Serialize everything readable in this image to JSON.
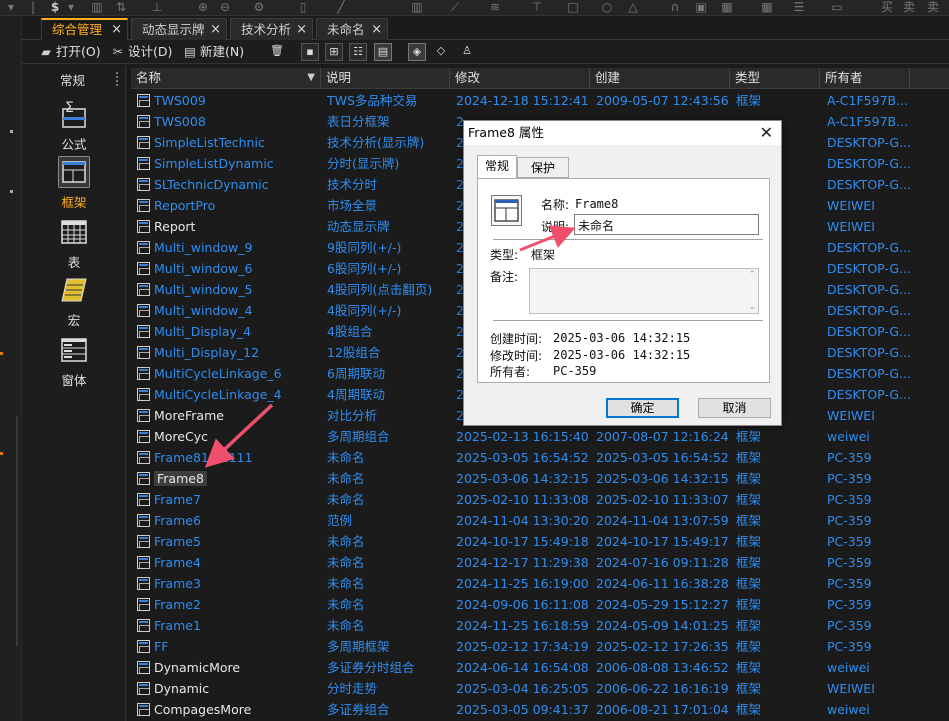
{
  "tabs": [
    {
      "label": "综合管理",
      "active": true
    },
    {
      "label": "动态显示牌",
      "active": false
    },
    {
      "label": "技术分析",
      "active": false
    },
    {
      "label": "未命名",
      "active": false
    }
  ],
  "toolbar": {
    "open_label": "打开(O)",
    "design_label": "设计(D)",
    "new_label": "新建(N)"
  },
  "sidebar": {
    "title": "常规",
    "items": [
      {
        "label": "公式",
        "icon": "formula-icon",
        "selected": false
      },
      {
        "label": "框架",
        "icon": "frame-icon",
        "selected": true
      },
      {
        "label": "表",
        "icon": "table-icon",
        "selected": false
      },
      {
        "label": "宏",
        "icon": "macro-icon",
        "selected": false
      },
      {
        "label": "窗体",
        "icon": "form-icon",
        "selected": false
      }
    ]
  },
  "grid": {
    "columns": [
      "名称",
      "说明",
      "修改",
      "创建",
      "类型",
      "所有者"
    ],
    "rows": [
      {
        "name": "TWS009",
        "desc": "TWS多品种交易",
        "modified": "2024-12-18 15:12:41",
        "created": "2009-05-07 12:43:56",
        "type": "框架",
        "owner": "A-C1F597B...",
        "name_color": "blue"
      },
      {
        "name": "TWS008",
        "desc": "表日分框架",
        "modified": "2",
        "created": "",
        "type": "",
        "owner": "A-C1F597B...",
        "name_color": "blue"
      },
      {
        "name": "SimpleListTechnic",
        "desc": "技术分析(显示牌)",
        "modified": "2",
        "created": "",
        "type": "",
        "owner": "DESKTOP-G...",
        "name_color": "blue"
      },
      {
        "name": "SimpleListDynamic",
        "desc": "分时(显示牌)",
        "modified": "2",
        "created": "",
        "type": "",
        "owner": "DESKTOP-G...",
        "name_color": "blue"
      },
      {
        "name": "SLTechnicDynamic",
        "desc": "技术分时",
        "modified": "2",
        "created": "",
        "type": "",
        "owner": "DESKTOP-G...",
        "name_color": "blue"
      },
      {
        "name": "ReportPro",
        "desc": "市场全景",
        "modified": "2",
        "created": "",
        "type": "",
        "owner": "WEIWEI",
        "name_color": "blue"
      },
      {
        "name": "Report",
        "desc": "动态显示牌",
        "modified": "2",
        "created": "",
        "type": "",
        "owner": "WEIWEI",
        "name_color": "white"
      },
      {
        "name": "Multi_window_9",
        "desc": "9股同列(+/-)",
        "modified": "2",
        "created": "",
        "type": "",
        "owner": "DESKTOP-G...",
        "name_color": "blue"
      },
      {
        "name": "Multi_window_6",
        "desc": "6股同列(+/-)",
        "modified": "2",
        "created": "",
        "type": "",
        "owner": "DESKTOP-G...",
        "name_color": "blue"
      },
      {
        "name": "Multi_window_5",
        "desc": "4股同列(点击翻页)",
        "modified": "2",
        "created": "",
        "type": "",
        "owner": "DESKTOP-G...",
        "name_color": "blue"
      },
      {
        "name": "Multi_window_4",
        "desc": "4股同列(+/-)",
        "modified": "2",
        "created": "",
        "type": "",
        "owner": "DESKTOP-G...",
        "name_color": "blue"
      },
      {
        "name": "Multi_Display_4",
        "desc": "4股组合",
        "modified": "2",
        "created": "",
        "type": "",
        "owner": "DESKTOP-G...",
        "name_color": "blue"
      },
      {
        "name": "Multi_Display_12",
        "desc": "12股组合",
        "modified": "2",
        "created": "",
        "type": "",
        "owner": "DESKTOP-G...",
        "name_color": "blue"
      },
      {
        "name": "MultiCycleLinkage_6",
        "desc": "6周期联动",
        "modified": "2",
        "created": "",
        "type": "",
        "owner": "DESKTOP-G...",
        "name_color": "blue"
      },
      {
        "name": "MultiCycleLinkage_4",
        "desc": "4周期联动",
        "modified": "2",
        "created": "",
        "type": "",
        "owner": "DESKTOP-G...",
        "name_color": "blue"
      },
      {
        "name": "MoreFrame",
        "desc": "对比分析",
        "modified": "2",
        "created": "",
        "type": "",
        "owner": "WEIWEI",
        "name_color": "white"
      },
      {
        "name": "MoreCyc",
        "desc": "多周期组合",
        "modified": "2025-02-13 16:15:40",
        "created": "2007-08-07 12:16:24",
        "type": "框架",
        "owner": "weiwei",
        "name_color": "white"
      },
      {
        "name": "Frame811  1111",
        "desc": "未命名",
        "modified": "2025-03-05 16:54:52",
        "created": "2025-03-05 16:54:52",
        "type": "框架",
        "owner": "PC-359",
        "name_color": "blue"
      },
      {
        "name": "Frame8",
        "desc": "未命名",
        "modified": "2025-03-06 14:32:15",
        "created": "2025-03-06 14:32:15",
        "type": "框架",
        "owner": "PC-359",
        "name_color": "white",
        "highlight": true
      },
      {
        "name": "Frame7",
        "desc": "未命名",
        "modified": "2025-02-10 11:33:08",
        "created": "2025-02-10 11:33:07",
        "type": "框架",
        "owner": "PC-359",
        "name_color": "blue"
      },
      {
        "name": "Frame6",
        "desc": "范例",
        "modified": "2024-11-04 13:30:20",
        "created": "2024-11-04 13:07:59",
        "type": "框架",
        "owner": "PC-359",
        "name_color": "blue"
      },
      {
        "name": "Frame5",
        "desc": "未命名",
        "modified": "2024-10-17 15:49:18",
        "created": "2024-10-17 15:49:17",
        "type": "框架",
        "owner": "PC-359",
        "name_color": "blue"
      },
      {
        "name": "Frame4",
        "desc": "未命名",
        "modified": "2024-12-17 11:29:38",
        "created": "2024-07-16 09:11:28",
        "type": "框架",
        "owner": "PC-359",
        "name_color": "blue"
      },
      {
        "name": "Frame3",
        "desc": "未命名",
        "modified": "2024-11-25 16:19:00",
        "created": "2024-06-11 16:38:28",
        "type": "框架",
        "owner": "PC-359",
        "name_color": "blue"
      },
      {
        "name": "Frame2",
        "desc": "未命名",
        "modified": "2024-09-06 16:11:08",
        "created": "2024-05-29 15:12:27",
        "type": "框架",
        "owner": "PC-359",
        "name_color": "blue"
      },
      {
        "name": "Frame1",
        "desc": "未命名",
        "modified": "2024-11-25 16:18:59",
        "created": "2024-05-09 14:01:25",
        "type": "框架",
        "owner": "PC-359",
        "name_color": "blue"
      },
      {
        "name": "FF",
        "desc": "多周期框架",
        "modified": "2025-02-12 17:34:19",
        "created": "2025-02-12 17:26:35",
        "type": "框架",
        "owner": "PC-359",
        "name_color": "blue"
      },
      {
        "name": "DynamicMore",
        "desc": "多证券分时组合",
        "modified": "2024-06-14 16:54:08",
        "created": "2006-08-08 13:46:52",
        "type": "框架",
        "owner": "weiwei",
        "name_color": "white"
      },
      {
        "name": "Dynamic",
        "desc": "分时走势",
        "modified": "2025-03-04 16:25:05",
        "created": "2006-06-22 16:16:19",
        "type": "框架",
        "owner": "WEIWEI",
        "name_color": "white"
      },
      {
        "name": "CompagesMore",
        "desc": "多证券组合",
        "modified": "2025-03-05 09:41:37",
        "created": "2006-08-21 17:01:04",
        "type": "框架",
        "owner": "weiwei",
        "name_color": "white"
      }
    ]
  },
  "dialog": {
    "title": "Frame8 属性",
    "tabs": [
      "常规",
      "保护"
    ],
    "name_label": "名称:",
    "name_value": "Frame8",
    "desc_label": "说明:",
    "desc_value": "未命名",
    "type_label": "类型:",
    "type_value": "框架",
    "note_label": "备注:",
    "created_label": "创建时间:",
    "created_value": "2025-03-06 14:32:15",
    "modified_label": "修改时间:",
    "modified_value": "2025-03-06 14:32:15",
    "owner_label": "所有者:",
    "owner_value": "PC-359",
    "ok_label": "确定",
    "cancel_label": "取消"
  },
  "colors": {
    "accent": "#ffae1a",
    "link_blue": "#2f8df0",
    "annotation_arrow": "#f0506e"
  }
}
